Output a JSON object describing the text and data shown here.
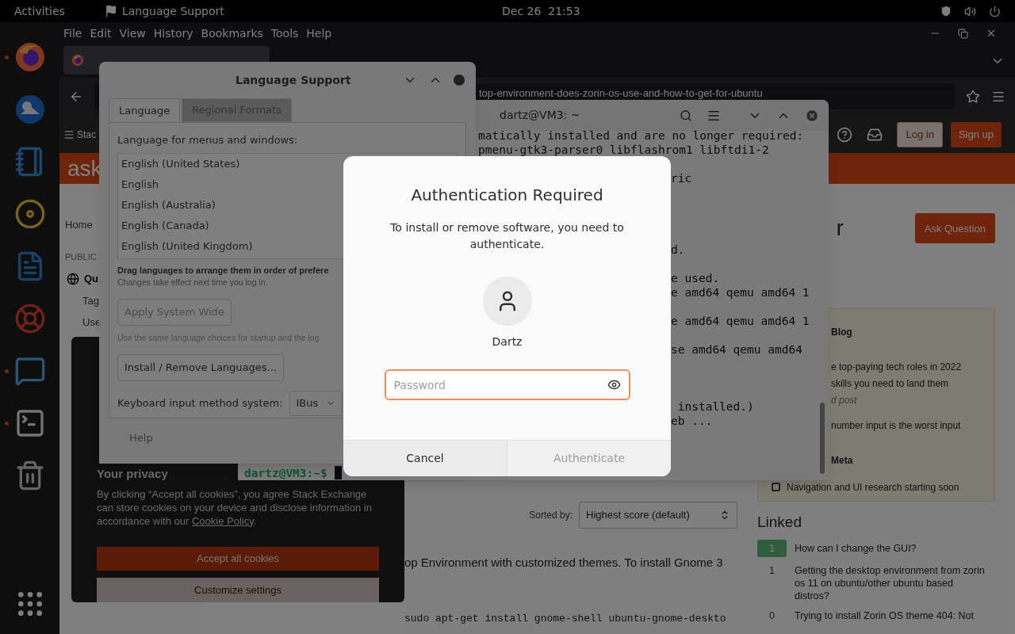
{
  "top_bar": {
    "activities": "Activities",
    "app_name": "Language Support",
    "clock": "Dec 26  21:53"
  },
  "dock": {
    "items": [
      {
        "running": true
      },
      {
        "running": false
      },
      {
        "running": false
      },
      {
        "running": false
      },
      {
        "running": false
      },
      {
        "running": false
      },
      {
        "running": true
      },
      {
        "running": true
      },
      {
        "running": false
      }
    ]
  },
  "browser": {
    "menu": [
      "File",
      "Edit",
      "View",
      "History",
      "Bookmarks",
      "Tools",
      "Help"
    ],
    "url": "top-environment-does-zorin-os-use-and-how-to-get-for-ubuntu",
    "site_menu": "Stac",
    "login": "Log in",
    "signup": "Sign up",
    "logo": "ask",
    "nav": [
      {
        "kind": "link",
        "text": "Home"
      },
      {
        "kind": "heading",
        "text": "PUBLIC"
      },
      {
        "kind": "current",
        "text": "Qu"
      },
      {
        "kind": "sub",
        "text": "Tag"
      },
      {
        "kind": "sub",
        "text": "Use"
      }
    ],
    "question_title": "r",
    "ask_button": "Ask Question",
    "blog": {
      "heading": "Blog",
      "posts": [
        {
          "lines": [
            "e top-paying tech roles in 2022",
            "skills you need to land them"
          ],
          "note": "d post"
        },
        {
          "lines": [
            "number input is the worst input"
          ]
        }
      ]
    },
    "meta": {
      "heading": "Meta",
      "posts": [
        "Navigation and UI research starting soon"
      ]
    },
    "sort_label": "Sorted by:",
    "sort_value": "Highest score (default)",
    "answer_text": "op Environment with customized themes. To install Gnome 3",
    "answer_code": "sudo apt-get install gnome-shell ubuntu-gnome-deskto",
    "linked_heading": "Linked",
    "linked": [
      {
        "score": "1",
        "accepted": true,
        "title": "How can I change the GUI?"
      },
      {
        "score": "1",
        "accepted": false,
        "title": "Getting the desktop environment from zorin os 11 on ubuntu/other ubuntu based distros?"
      },
      {
        "score": "0",
        "accepted": false,
        "title": "Trying to install Zorin OS theme 404: Not"
      }
    ],
    "cookie": {
      "title": "Your privacy",
      "text_before": "By clicking “Accept all cookies”, you agree Stack Exchange can store cookies on your device and disclose information in accordance with our ",
      "link": "Cookie Policy",
      "text_after": ".",
      "accept": "Accept all cookies",
      "customize": "Customize settings"
    }
  },
  "terminal": {
    "title": "dartz@VM3: ~",
    "lines": [
      {
        "text": "matically installed and are no longer required:"
      },
      {
        "text": "pmenu-gtk3-parser0 libflashrom1 libftdi1-2"
      },
      {
        "text": "ric"
      },
      {
        "text": "d."
      },
      {
        "text": "e used."
      },
      {
        "text": "e amd64 qemu amd64 1"
      },
      {
        "text": "e amd64 qemu amd64 1"
      },
      {
        "text": "se amd64 qemu amd64"
      },
      {
        "text": " installed.)"
      },
      {
        "text": "eb ..."
      }
    ],
    "prompt": "dartz@VM3:~$"
  },
  "language_support": {
    "title": "Language Support",
    "tabs": [
      {
        "label": "Language",
        "selected": true
      },
      {
        "label": "Regional Formats",
        "selected": false
      }
    ],
    "list_label": "Language for menus and windows:",
    "languages": [
      "English (United States)",
      "English",
      "English (Australia)",
      "English (Canada)",
      "English (United Kingdom)"
    ],
    "drag_hint": "Drag languages to arrange them in order of prefere",
    "changes_note": "Changes take effect next time you log in.",
    "apply_button": "Apply System Wide",
    "same_note": "Use the same language choices for startup and the log",
    "install_button": "Install / Remove Languages...",
    "input_label": "Keyboard input method system:",
    "input_value": "IBus",
    "help_button": "Help"
  },
  "auth_dialog": {
    "title": "Authentication Required",
    "message": "To install or remove software, you need to authenticate.",
    "user": "Dartz",
    "password": {
      "placeholder": "Password",
      "focused": true
    },
    "cancel": "Cancel",
    "authenticate": {
      "label": "Authenticate",
      "disabled": true
    }
  }
}
